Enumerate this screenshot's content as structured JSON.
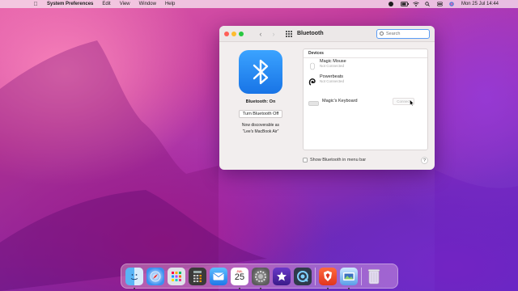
{
  "menubar": {
    "app_name": "System Preferences",
    "menus": [
      "Edit",
      "View",
      "Window",
      "Help"
    ],
    "clock": "Mon 25 Jul  14:44"
  },
  "window": {
    "title": "Bluetooth",
    "search_placeholder": "Search"
  },
  "bluetooth": {
    "status": "Bluetooth: On",
    "toggle_label": "Turn Bluetooth Off",
    "discoverable_line1": "Now discoverable as",
    "discoverable_line2": "“Lee's MacBook Air”"
  },
  "devices": {
    "header": "Devices",
    "items": [
      {
        "name": "Magic Mouse",
        "status": "Not Connected",
        "icon": "mouse-icon"
      },
      {
        "name": "Powerbeats",
        "status": "Not Connected",
        "icon": "earphones-icon"
      },
      {
        "name": "Magic's Keyboard",
        "status": "",
        "icon": "keyboard-icon",
        "action": "Connect"
      }
    ]
  },
  "footer": {
    "show_in_menubar": "Show Bluetooth in menu bar",
    "help": "?"
  },
  "dock": {
    "calendar_month": "JUL",
    "calendar_day": "25",
    "apps": [
      "finder-icon",
      "safari-icon",
      "launchpad-icon",
      "calculator-icon",
      "mail-icon",
      "calendar-icon",
      "system-preferences-icon",
      "imovie-icon",
      "quicktime-icon",
      "brave-icon",
      "preview-icon",
      "trash-icon"
    ]
  },
  "colors": {
    "bluetooth_blue": "#1874e6",
    "accent": "#5b9cf5"
  }
}
